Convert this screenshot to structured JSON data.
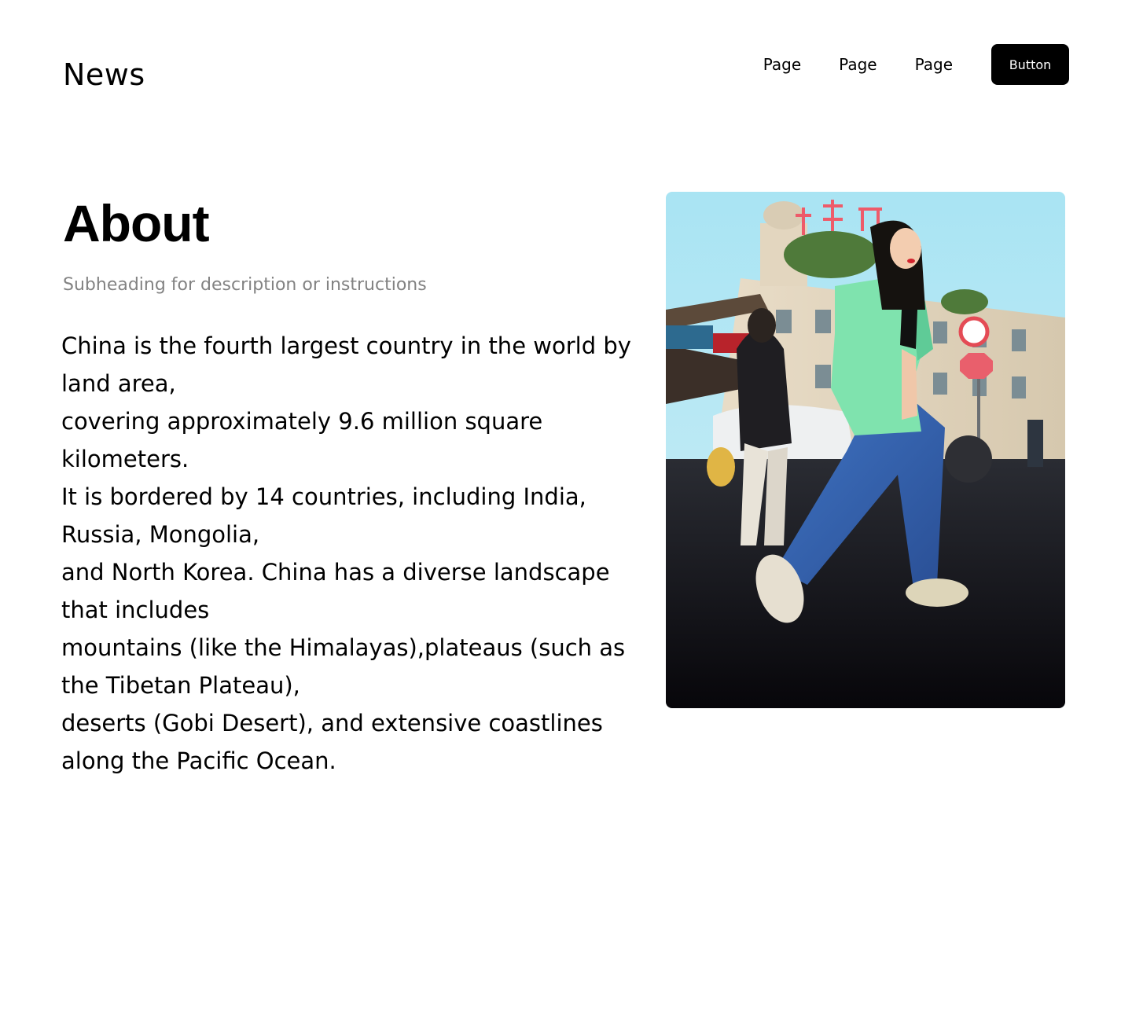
{
  "header": {
    "brand": "News",
    "nav": [
      {
        "label": "Page"
      },
      {
        "label": "Page"
      },
      {
        "label": "Page"
      }
    ],
    "button_label": "Button"
  },
  "main": {
    "title": "About",
    "subheading": "Subheading for description or instructions",
    "paragraph_lines": [
      "China is the fourth largest country in the world by land area,",
      "covering approximately 9.6 million square kilometers.",
      "It is bordered by 14 countries, including India, Russia, Mongolia,",
      "and North Korea. China has a diverse landscape that includes",
      "mountains (like the Himalayas),plateaus (such as the Tibetan Plateau),",
      "deserts (Gobi Desert), and extensive coastlines along the Pacific Ocean."
    ]
  },
  "colors": {
    "background": "#ffffff",
    "text": "#000000",
    "subheading": "#828282",
    "button_bg": "#000000",
    "button_text": "#ffffff"
  }
}
